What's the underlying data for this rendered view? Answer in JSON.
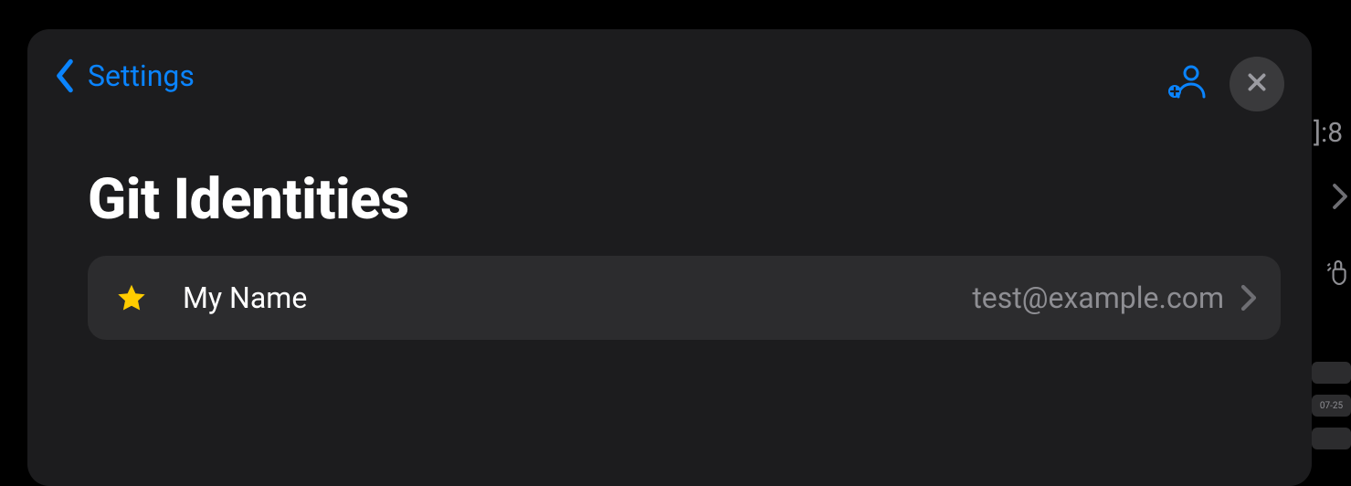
{
  "nav": {
    "back_label": "Settings"
  },
  "page": {
    "title": "Git Identities"
  },
  "identities": [
    {
      "name": "My Name",
      "email": "test@example.com",
      "is_default": true
    }
  ],
  "background": {
    "fragment_text": "]:8",
    "pill_1": "",
    "pill_2": "07-25",
    "pill_3": ""
  },
  "colors": {
    "accent": "#0a84ff",
    "star": "#ffcc00",
    "sheet_bg": "#1c1c1e",
    "row_bg": "#2c2c2e",
    "secondary_text": "#8e8e93"
  }
}
